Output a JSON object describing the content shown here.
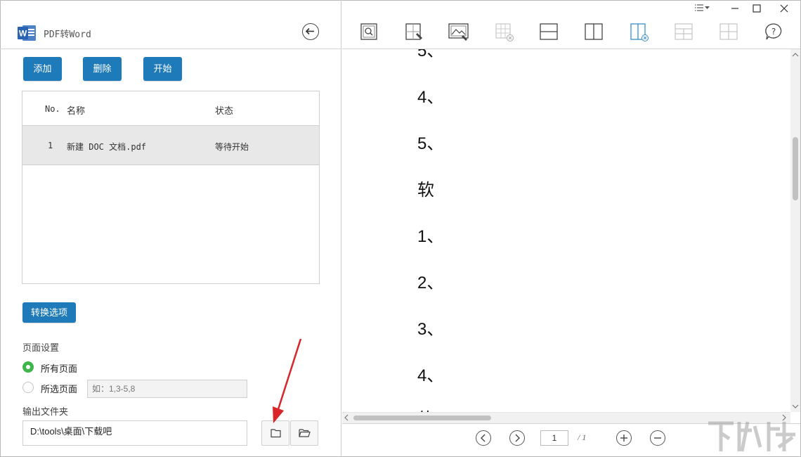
{
  "app": {
    "title": "PDF转Word",
    "logo_letter": "W"
  },
  "toolbar_left": {
    "add_label": "添加",
    "delete_label": "删除",
    "start_label": "开始"
  },
  "file_table": {
    "columns": {
      "no": "No.",
      "name": "名称",
      "status": "状态"
    },
    "rows": [
      {
        "no": "1",
        "name": "新建 DOC 文档.pdf",
        "status": "等待开始"
      }
    ]
  },
  "options": {
    "convert_options_label": "转换选项"
  },
  "page_settings": {
    "label": "页面设置",
    "all_pages": "所有页面",
    "selected_pages": "所选页面",
    "range_placeholder": "如：1,3-5,8",
    "selected": "all"
  },
  "output": {
    "label": "输出文件夹",
    "path": "D:\\tools\\桌面\\下载吧"
  },
  "document": {
    "lines": [
      "5、",
      "4、",
      "5、",
      "软",
      "1、",
      "2、",
      "3、",
      "4、",
      "软"
    ]
  },
  "pager": {
    "current_page": "1",
    "total": "/ 1"
  },
  "toolbar_right_icons": [
    "zoom-page-icon",
    "text-select-icon",
    "image-select-icon",
    "table-delete-icon",
    "horizontal-split-icon",
    "vertical-split-icon",
    "column-delete-icon",
    "table-layout-icon",
    "grid-icon",
    "help-icon"
  ],
  "colors": {
    "accent": "#1e7ab8",
    "radio_on": "#3fb54a",
    "arrow": "#d9252a"
  },
  "watermark": {
    "text": "下载吧"
  }
}
